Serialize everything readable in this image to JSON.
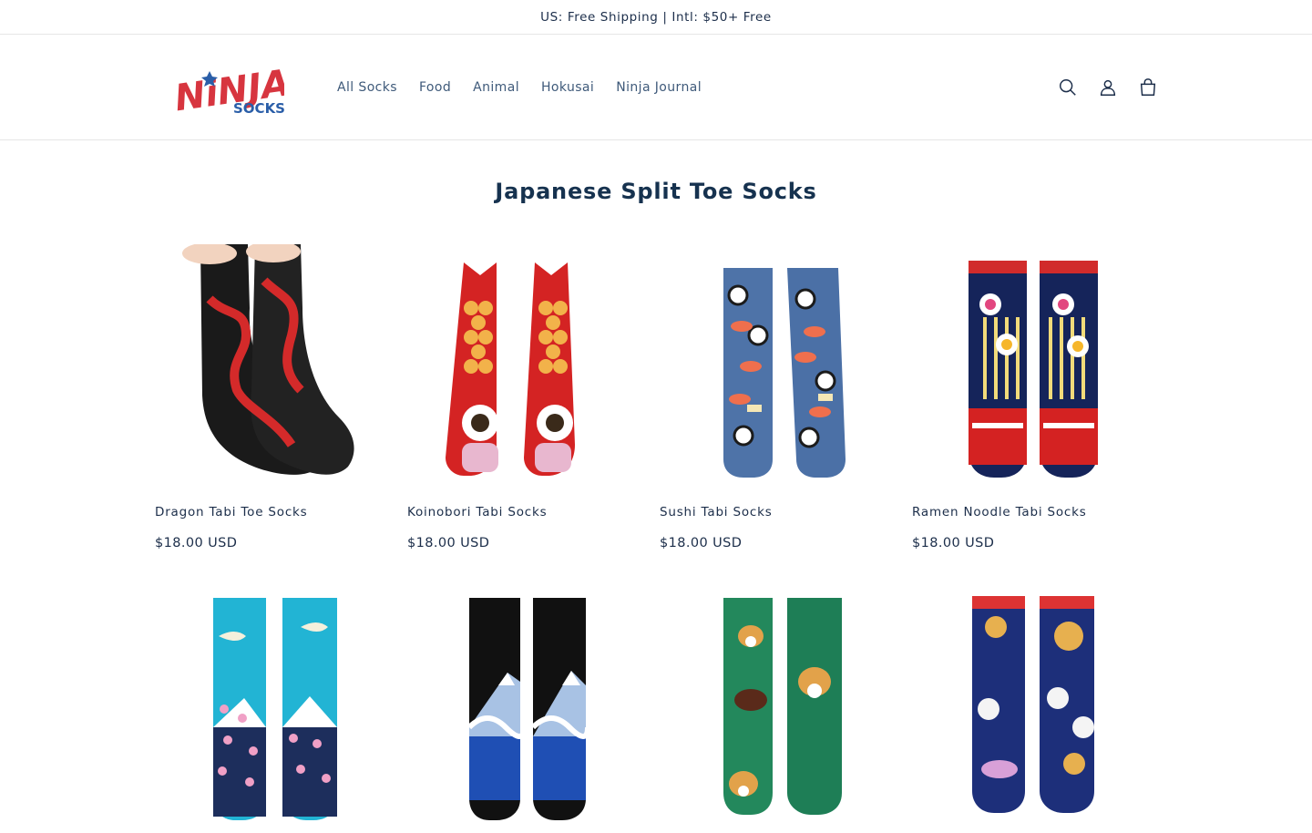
{
  "announcement": {
    "text": "US: Free Shipping | Intl: $50+ Free"
  },
  "logo": {
    "line1": "NiNJA",
    "line2": "SOCKS"
  },
  "nav": [
    "All Socks",
    "Food",
    "Animal",
    "Hokusai",
    "Ninja Journal"
  ],
  "icons": {
    "search": "search-icon",
    "account": "user-icon",
    "cart": "cart-icon"
  },
  "collection": {
    "title": "Japanese Split Toe Socks"
  },
  "products": [
    {
      "name": "Dragon Tabi Toe Socks",
      "price": "$18.00 USD"
    },
    {
      "name": "Koinobori Tabi Socks",
      "price": "$18.00 USD"
    },
    {
      "name": "Sushi Tabi Socks",
      "price": "$18.00 USD"
    },
    {
      "name": "Ramen Noodle Tabi Socks",
      "price": "$18.00 USD"
    },
    {
      "name": "",
      "price": ""
    },
    {
      "name": "",
      "price": ""
    },
    {
      "name": "",
      "price": ""
    },
    {
      "name": "",
      "price": ""
    }
  ],
  "colors": {
    "brand_red": "#d7353f",
    "brand_blue": "#2a5ea8",
    "text": "#1c2e4a"
  }
}
